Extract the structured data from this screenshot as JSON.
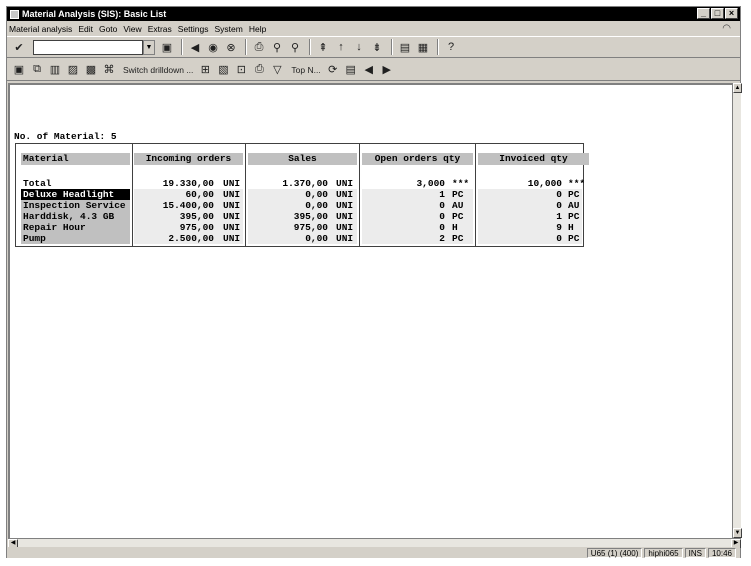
{
  "window": {
    "title": "Material Analysis (SIS): Basic List",
    "controls": [
      "_",
      "□",
      "×"
    ]
  },
  "menu": [
    "Material analysis",
    "Edit",
    "Goto",
    "View",
    "Extras",
    "Settings",
    "System",
    "Help"
  ],
  "toolbar": {
    "command_value": "",
    "switch_drilldown_label": "Switch drilldown ...",
    "top_n_label": "Top N..."
  },
  "report": {
    "count_label": "No. of Material: 5",
    "headers": [
      "Material",
      "Incoming orders",
      "Sales",
      "Open orders qty",
      "Invoiced qty"
    ],
    "total": {
      "label": "Total",
      "incoming": "19.330,00",
      "incoming_unit": "UNI",
      "sales": "1.370,00",
      "sales_unit": "UNI",
      "open": "3,000",
      "open_unit": "***",
      "invoiced": "10,000",
      "invoiced_unit": "***"
    },
    "rows": [
      {
        "material": "Deluxe Headlight",
        "incoming": "60,00",
        "incoming_unit": "UNI",
        "sales": "0,00",
        "sales_unit": "UNI",
        "open": "1",
        "open_unit": "PC",
        "invoiced": "0",
        "invoiced_unit": "PC",
        "selected": true
      },
      {
        "material": "Inspection Service",
        "incoming": "15.400,00",
        "incoming_unit": "UNI",
        "sales": "0,00",
        "sales_unit": "UNI",
        "open": "0",
        "open_unit": "AU",
        "invoiced": "0",
        "invoiced_unit": "AU",
        "selected": false
      },
      {
        "material": "Harddisk, 4.3 GB",
        "incoming": "395,00",
        "incoming_unit": "UNI",
        "sales": "395,00",
        "sales_unit": "UNI",
        "open": "0",
        "open_unit": "PC",
        "invoiced": "1",
        "invoiced_unit": "PC",
        "selected": false
      },
      {
        "material": "Repair Hour",
        "incoming": "975,00",
        "incoming_unit": "UNI",
        "sales": "975,00",
        "sales_unit": "UNI",
        "open": "0",
        "open_unit": "H",
        "invoiced": "9",
        "invoiced_unit": "H",
        "selected": false
      },
      {
        "material": "Pump",
        "incoming": "2.500,00",
        "incoming_unit": "UNI",
        "sales": "0,00",
        "sales_unit": "UNI",
        "open": "2",
        "open_unit": "PC",
        "invoiced": "0",
        "invoiced_unit": "PC",
        "selected": false
      }
    ]
  },
  "status": {
    "system": "U65 (1) (400)",
    "server": "hiphi065",
    "mode": "INS",
    "time": "10:46"
  },
  "colors": {
    "title_bg": "#000000",
    "chrome": "#d4d0c8",
    "header_cell": "#c0c0c0",
    "selected_row": "#000000"
  }
}
